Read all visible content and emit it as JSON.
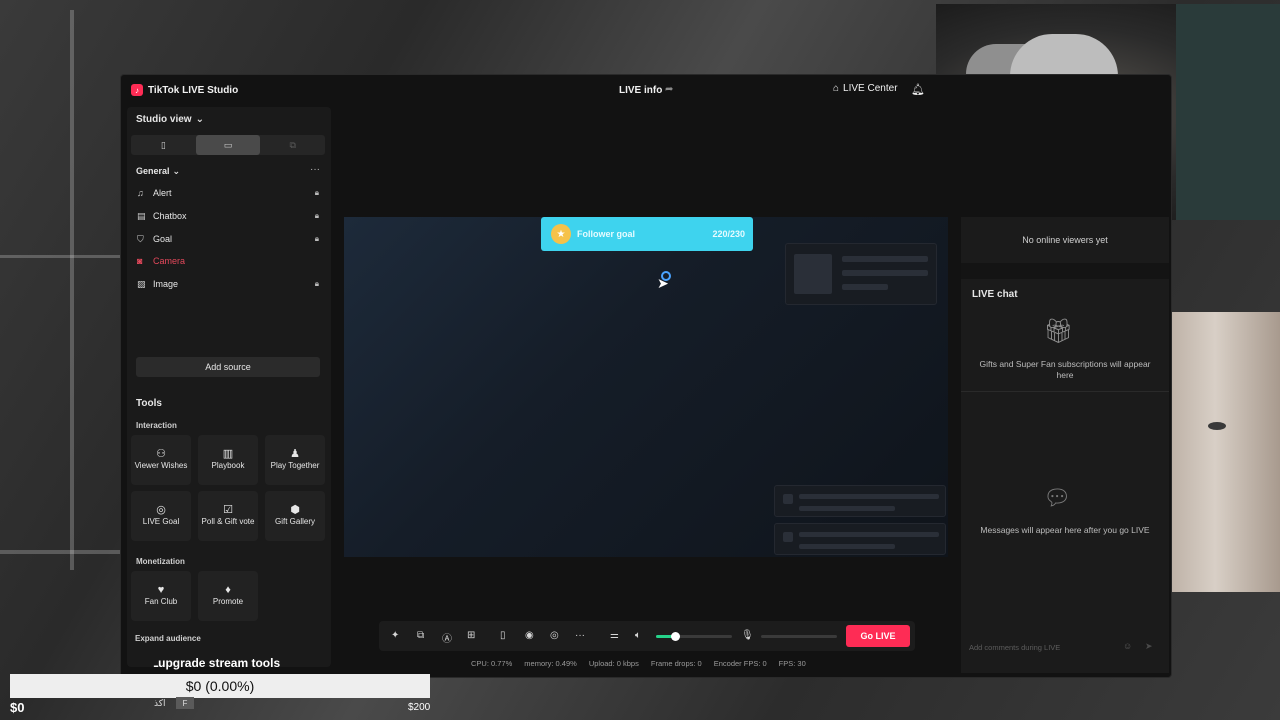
{
  "app": {
    "title": "TikTok LIVE Studio",
    "live_info": "LIVE info",
    "live_center": "LIVE Center"
  },
  "sidebar": {
    "studio_view": "Studio view",
    "general": "General",
    "sources": [
      {
        "label": "Alert",
        "icon": "bell-icon",
        "locked": true
      },
      {
        "label": "Chatbox",
        "icon": "chat-icon",
        "locked": true
      },
      {
        "label": "Goal",
        "icon": "shield-icon",
        "locked": true
      },
      {
        "label": "Camera",
        "icon": "camera-icon",
        "locked": false,
        "color": "#e3485b"
      },
      {
        "label": "Image",
        "icon": "image-icon",
        "locked": true
      }
    ],
    "add_source": "Add source",
    "tools": "Tools",
    "interaction": "Interaction",
    "interaction_tools": [
      {
        "label": "Viewer Wishes",
        "icon": "users-icon"
      },
      {
        "label": "Playbook",
        "icon": "book-icon"
      },
      {
        "label": "Play Together",
        "icon": "person-icon"
      },
      {
        "label": "LIVE Goal",
        "icon": "target-icon"
      },
      {
        "label": "Poll & Gift vote",
        "icon": "poll-icon"
      },
      {
        "label": "Gift Gallery",
        "icon": "gift-gallery-icon"
      }
    ],
    "monetization": "Monetization",
    "monetization_tools": [
      {
        "label": "Fan Club",
        "icon": "heart-icon"
      },
      {
        "label": "Promote",
        "icon": "flame-icon"
      }
    ],
    "expand_audience": "Expand audience"
  },
  "preview": {
    "goal_title": "Follower goal",
    "goal_count": "220/230"
  },
  "right_panel": {
    "no_viewers": "No online viewers yet",
    "chat_title": "LIVE chat",
    "gifts_text": "Gifts and Super Fan subscriptions will appear here",
    "messages_text": "Messages will appear here after you go LIVE",
    "comment_placeholder": "Add comments during LIVE"
  },
  "toolbar": {
    "go_live": "Go LIVE",
    "volume_level": 0.25
  },
  "status": {
    "cpu": "CPU: 0.77%",
    "memory": "memory: 0.49%",
    "upload": "Upload: 0 kbps",
    "frame_drops": "Frame drops: 0",
    "encoder_fps": "Encoder FPS: 0",
    "fps": "FPS: 30"
  },
  "overlay": {
    "upgrade_text": "ـupgrade stream tools",
    "goal_text": "$0 (0.00%)",
    "goal_min": "$0",
    "goal_max": "$200",
    "goal_progress": 0,
    "arabic_text": "اكذ",
    "tiny_label": "F"
  },
  "colors": {
    "accent": "#fe2c55",
    "goal_widget": "#3ed3ee",
    "volume": "#25d38a"
  }
}
